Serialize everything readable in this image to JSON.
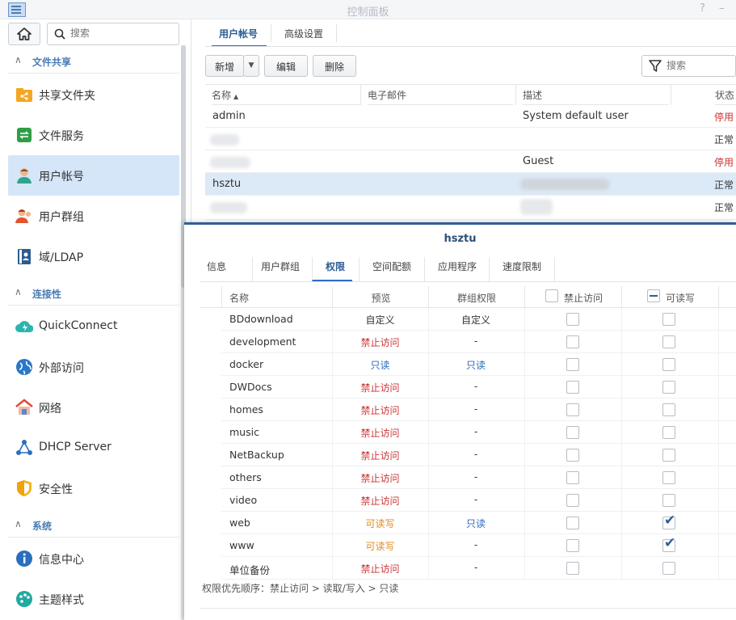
{
  "window": {
    "title": "控制面板",
    "help": "?",
    "minimize": "–"
  },
  "search": {
    "placeholder": "搜索"
  },
  "sidebar": {
    "sections": [
      {
        "label": "文件共享",
        "items": [
          {
            "label": "共享文件夹",
            "icon": "shared-folder-icon"
          },
          {
            "label": "文件服务",
            "icon": "file-services-icon"
          },
          {
            "label": "用户帐号",
            "icon": "user-icon",
            "active": true
          },
          {
            "label": "用户群组",
            "icon": "group-icon"
          },
          {
            "label": "域/LDAP",
            "icon": "domain-icon"
          }
        ]
      },
      {
        "label": "连接性",
        "items": [
          {
            "label": "QuickConnect",
            "icon": "quickconnect-icon"
          },
          {
            "label": "外部访问",
            "icon": "globe-icon"
          },
          {
            "label": "网络",
            "icon": "network-icon"
          },
          {
            "label": "DHCP Server",
            "icon": "dhcp-icon"
          },
          {
            "label": "安全性",
            "icon": "shield-icon"
          }
        ]
      },
      {
        "label": "系统",
        "items": [
          {
            "label": "信息中心",
            "icon": "info-icon"
          },
          {
            "label": "主题样式",
            "icon": "palette-icon"
          }
        ]
      }
    ]
  },
  "main": {
    "tabs": [
      "用户帐号",
      "高级设置"
    ],
    "toolbar": {
      "add": "新增",
      "edit": "编辑",
      "delete": "删除",
      "filter_placeholder": "搜索"
    },
    "columns": [
      "名称",
      "电子邮件",
      "描述",
      "状态"
    ],
    "rows": [
      {
        "name": "admin",
        "email": "",
        "desc": "System default user",
        "status": "停用"
      },
      {
        "name": "",
        "email": "",
        "desc": "",
        "status": "正常"
      },
      {
        "name": "",
        "email": "",
        "desc": "Guest",
        "status": "停用"
      },
      {
        "name": "hsztu",
        "email": "",
        "desc": "",
        "status": "正常"
      },
      {
        "name": "",
        "email": "",
        "desc": "",
        "status": "正常"
      }
    ]
  },
  "popup": {
    "title": "hsztu",
    "tabs": [
      "信息",
      "用户群组",
      "权限",
      "空间配额",
      "应用程序",
      "速度限制"
    ],
    "columns": {
      "name": "名称",
      "preview": "预览",
      "group": "群组权限",
      "deny": "禁止访问",
      "rw": "可读写"
    },
    "rows": [
      {
        "name": "BDdownload",
        "preview": "自定义",
        "group": "自定义",
        "deny": false,
        "rw": false
      },
      {
        "name": "development",
        "preview": "禁止访问",
        "group": "-",
        "deny": false,
        "rw": false
      },
      {
        "name": "docker",
        "preview": "只读",
        "group": "只读",
        "deny": false,
        "rw": false
      },
      {
        "name": "DWDocs",
        "preview": "禁止访问",
        "group": "-",
        "deny": false,
        "rw": false
      },
      {
        "name": "homes",
        "preview": "禁止访问",
        "group": "-",
        "deny": false,
        "rw": false
      },
      {
        "name": "music",
        "preview": "禁止访问",
        "group": "-",
        "deny": false,
        "rw": false
      },
      {
        "name": "NetBackup",
        "preview": "禁止访问",
        "group": "-",
        "deny": false,
        "rw": false
      },
      {
        "name": "others",
        "preview": "禁止访问",
        "group": "-",
        "deny": false,
        "rw": false
      },
      {
        "name": "video",
        "preview": "禁止访问",
        "group": "-",
        "deny": false,
        "rw": false
      },
      {
        "name": "web",
        "preview": "可读写",
        "group": "只读",
        "deny": false,
        "rw": true
      },
      {
        "name": "www",
        "preview": "可读写",
        "group": "-",
        "deny": false,
        "rw": true
      },
      {
        "name": "单位备份",
        "preview": "禁止访问",
        "group": "-",
        "deny": false,
        "rw": false
      }
    ],
    "footer": "权限优先顺序：禁止访问 > 读取/写入 > 只读"
  },
  "colors": {
    "accent": "#2c6fc6",
    "deny": "#cc3333",
    "readwrite": "#e08a1e",
    "readonly": "#2d6bb8",
    "active_nav": "#d4e6f8"
  }
}
